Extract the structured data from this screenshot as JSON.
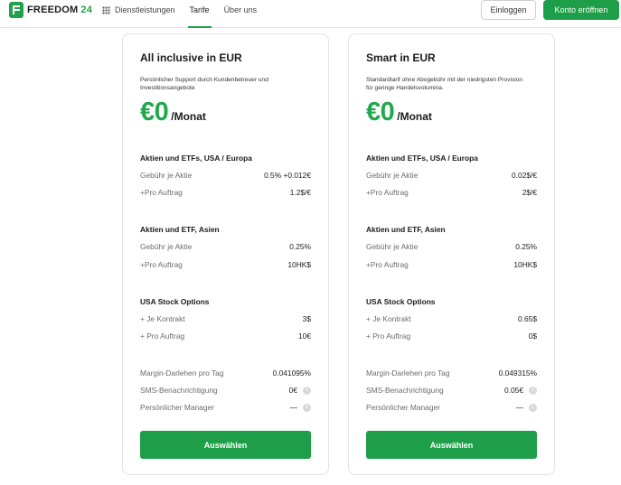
{
  "header": {
    "logo_text": "FREEDOM",
    "logo_num": "24",
    "nav": {
      "services": "Dienstleistungen",
      "tarife": "Tarife",
      "about": "Über uns"
    },
    "login": "Einloggen",
    "open_account": "Konto eröffnen"
  },
  "colors": {
    "accent": "#1e9e48",
    "price": "#1fa84d"
  },
  "plans": [
    {
      "title": "All inclusive in EUR",
      "desc": "Persönlicher Support durch Kundenbetreuer und Investitionsangebote",
      "price": "€0",
      "period": "/Monat",
      "sec1": {
        "title": "Aktien und ETFs, USA / Europa",
        "rows": [
          {
            "label": "Gebühr je Aktie",
            "value": "0.5% +0.012€"
          },
          {
            "label": "+Pro Auftrag",
            "value": "1.2$/€"
          }
        ]
      },
      "sec2": {
        "title": "Aktien und ETF, Asien",
        "rows": [
          {
            "label": "Gebühr je Aktie",
            "value": "0.25%"
          },
          {
            "label": "+Pro Auftrag",
            "value": "10HK$"
          }
        ]
      },
      "sec3": {
        "title": "USA Stock Options",
        "rows": [
          {
            "label": "+ Je Kontrakt",
            "value": "3$"
          },
          {
            "label": "+ Pro Auftrag",
            "value": "10€"
          }
        ]
      },
      "extra": [
        {
          "label": "Margin-Darlehen pro Tag",
          "value": "0.041095%"
        },
        {
          "label": "SMS-Benachrichtigung",
          "value": "0€"
        },
        {
          "label": "Persönlicher Manager",
          "value": "—"
        }
      ],
      "button": "Auswählen"
    },
    {
      "title": "Smart in EUR",
      "desc": "Standardtarif ohne Abogebühr mit der niedrigsten Provision für geringe Handelsvolumina.",
      "price": "€0",
      "period": "/Monat",
      "sec1": {
        "title": "Aktien und ETFs, USA / Europa",
        "rows": [
          {
            "label": "Gebühr je Aktie",
            "value": "0.02$/€"
          },
          {
            "label": "+Pro Auftrag",
            "value": "2$/€"
          }
        ]
      },
      "sec2": {
        "title": "Aktien und ETF, Asien",
        "rows": [
          {
            "label": "Gebühr je Aktie",
            "value": "0.25%"
          },
          {
            "label": "+Pro Auftrag",
            "value": "10HK$"
          }
        ]
      },
      "sec3": {
        "title": "USA Stock Options",
        "rows": [
          {
            "label": "+ Je Kontrakt",
            "value": "0.65$"
          },
          {
            "label": "+ Pro Auftrag",
            "value": "0$"
          }
        ]
      },
      "extra": [
        {
          "label": "Margin-Darlehen pro Tag",
          "value": "0.049315%"
        },
        {
          "label": "SMS-Benachrichtigung",
          "value": "0.05€"
        },
        {
          "label": "Persönlicher Manager",
          "value": "—"
        }
      ],
      "button": "Auswählen"
    }
  ]
}
